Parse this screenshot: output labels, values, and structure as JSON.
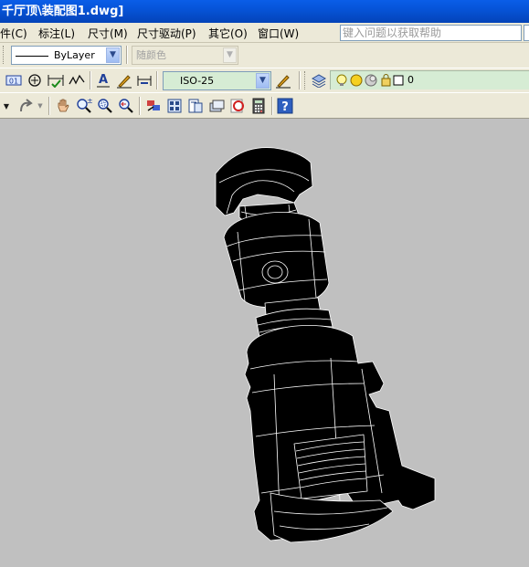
{
  "window": {
    "title": "厅顶\\装配图1.dwg]",
    "title_prefix": "千"
  },
  "menu": {
    "items": [
      {
        "label": "件(C)"
      },
      {
        "label": "标注(L)"
      },
      {
        "label": "尺寸(M)"
      },
      {
        "label": "尺寸驱动(P)"
      },
      {
        "label": "其它(O)"
      },
      {
        "label": "窗口(W)"
      }
    ],
    "help_placeholder": "键入问题以获取帮助"
  },
  "properties": {
    "linetype_value": "ByLayer",
    "color_value": "随颜色"
  },
  "dimstyle": {
    "value": "ISO-25"
  },
  "layer": {
    "current": "0"
  },
  "icons": {
    "tb2": [
      "dim-linear-icon",
      "center-mark-icon",
      "dim-continue-icon",
      "dim-jog-icon",
      "dim-text-icon",
      "dim-edit-icon",
      "dim-update-icon"
    ],
    "tb3": [
      "redo-icon",
      "pan-icon",
      "zoom-realtime-icon",
      "zoom-window-icon",
      "zoom-previous-icon",
      "properties-icon",
      "design-center-icon",
      "tool-palettes-icon",
      "sheet-set-icon",
      "markup-icon",
      "calculator-icon",
      "help-icon"
    ]
  },
  "colors": {
    "titlebar": "#0654d8",
    "toolbar": "#ece9d8",
    "viewport": "#c0c0c0",
    "model": "#000000",
    "edges": "#ffffff",
    "layer_strip": "#d6ecd4"
  }
}
